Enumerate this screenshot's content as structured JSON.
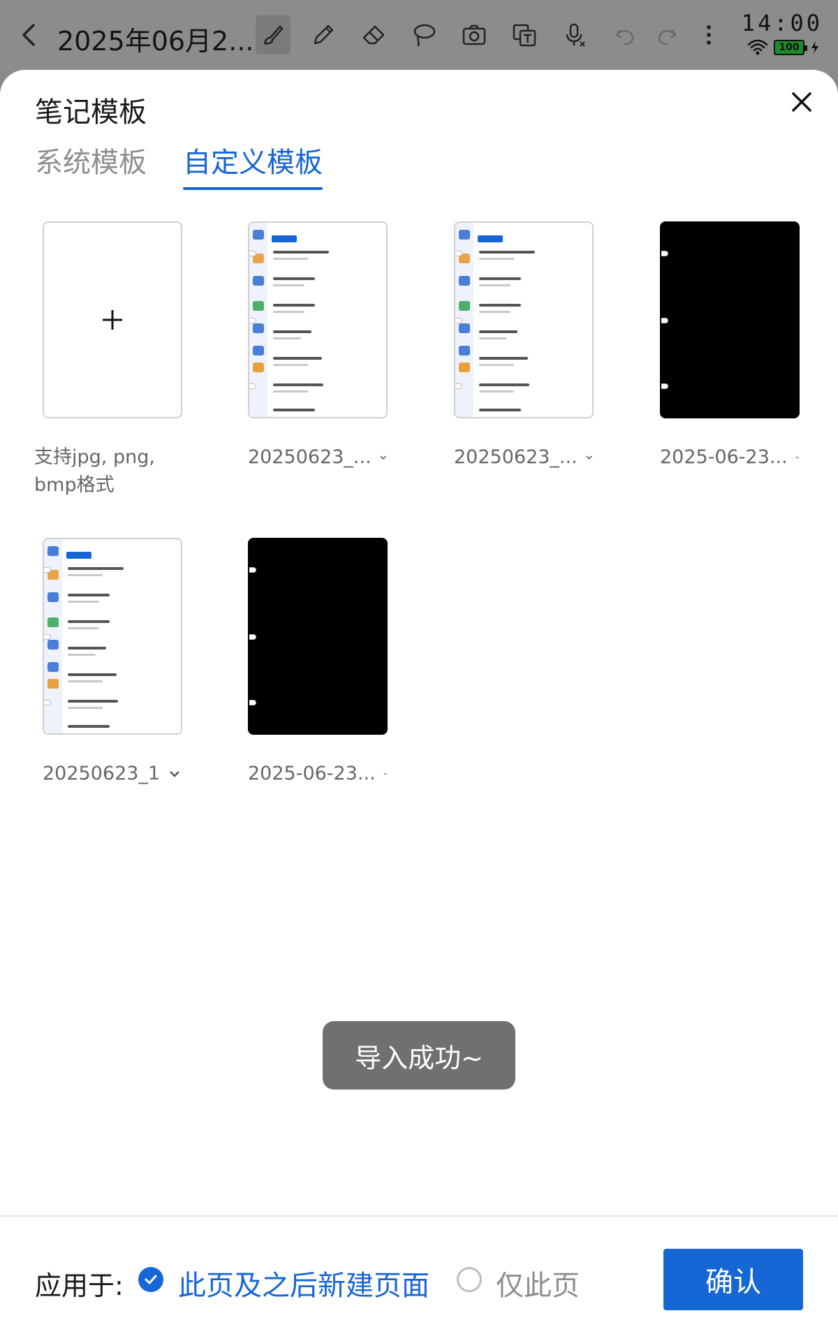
{
  "toolbar": {
    "title": "2025年06月2...",
    "clock": "14:00",
    "battery": "100",
    "tools": [
      "brush",
      "pencil",
      "eraser",
      "lasso",
      "camera",
      "translate",
      "voice",
      "undo",
      "redo",
      "more"
    ]
  },
  "sheet": {
    "title": "笔记模板",
    "tabs": [
      {
        "label": "系统模板",
        "active": false
      },
      {
        "label": "自定义模板",
        "active": true
      }
    ],
    "add_hint": "支持jpg, png, bmp格式",
    "templates": [
      {
        "label": "20250623_...",
        "kind": "screenshot"
      },
      {
        "label": "20250623_...",
        "kind": "screenshot"
      },
      {
        "label": "2025-06-23...",
        "kind": "black"
      },
      {
        "label": "20250623_1",
        "kind": "screenshot"
      },
      {
        "label": "2025-06-23...",
        "kind": "black"
      }
    ]
  },
  "toast": "导入成功~",
  "footer": {
    "apply_label": "应用于:",
    "option_1": "此页及之后新建页面",
    "option_2": "仅此页",
    "selected": "此页及之后新建页面",
    "confirm": "确认"
  },
  "colors": {
    "accent": "#1766d6",
    "toast_bg": "#707070",
    "scrim": "#8c8c8c"
  }
}
